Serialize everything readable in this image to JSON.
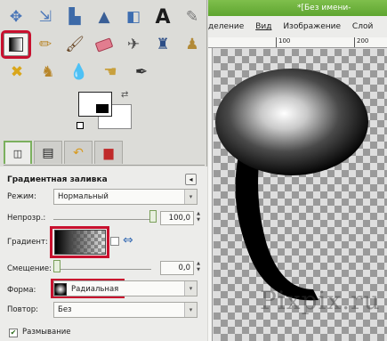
{
  "image_window": {
    "title": "*[Без имени-",
    "menu": [
      "деление",
      "Вид",
      "Изображение",
      "Слой"
    ],
    "ruler_marks": [
      "100",
      "200"
    ],
    "watermark": "Pixpix.ru"
  },
  "tool_options": {
    "title": "Градиентная заливка",
    "mode": {
      "label": "Режим:",
      "value": "Нормальный"
    },
    "opacity": {
      "label": "Непрозр.:",
      "value": "100,0",
      "level": 1.0
    },
    "gradient": {
      "label": "Градиент:"
    },
    "offset": {
      "label": "Смещение:",
      "value": "0,0",
      "level": 0.0
    },
    "shape": {
      "label": "Форма:",
      "value": "Радиальная"
    },
    "repeat": {
      "label": "Повтор:",
      "value": "Без"
    },
    "dithering": {
      "label": "Размывание",
      "checked": true
    }
  },
  "toolbox": {
    "tools": [
      [
        "align-icon",
        "move-icon",
        "crop-icon",
        "transform-icon",
        "flip-icon",
        "text-icon",
        "picker-icon"
      ],
      [
        "gradient-icon",
        "pencil-icon",
        "paintbrush-icon",
        "eraser-icon",
        "airbrush-icon",
        "ink-icon",
        "clone-icon"
      ],
      [
        "heal-icon",
        "perspective-clone-icon",
        "blur-icon",
        "smudge-icon",
        "dodge-icon"
      ]
    ],
    "active_tool": "gradient-icon"
  },
  "colors": {
    "highlight": "#c8102e",
    "titlebar": "#67ad38"
  }
}
